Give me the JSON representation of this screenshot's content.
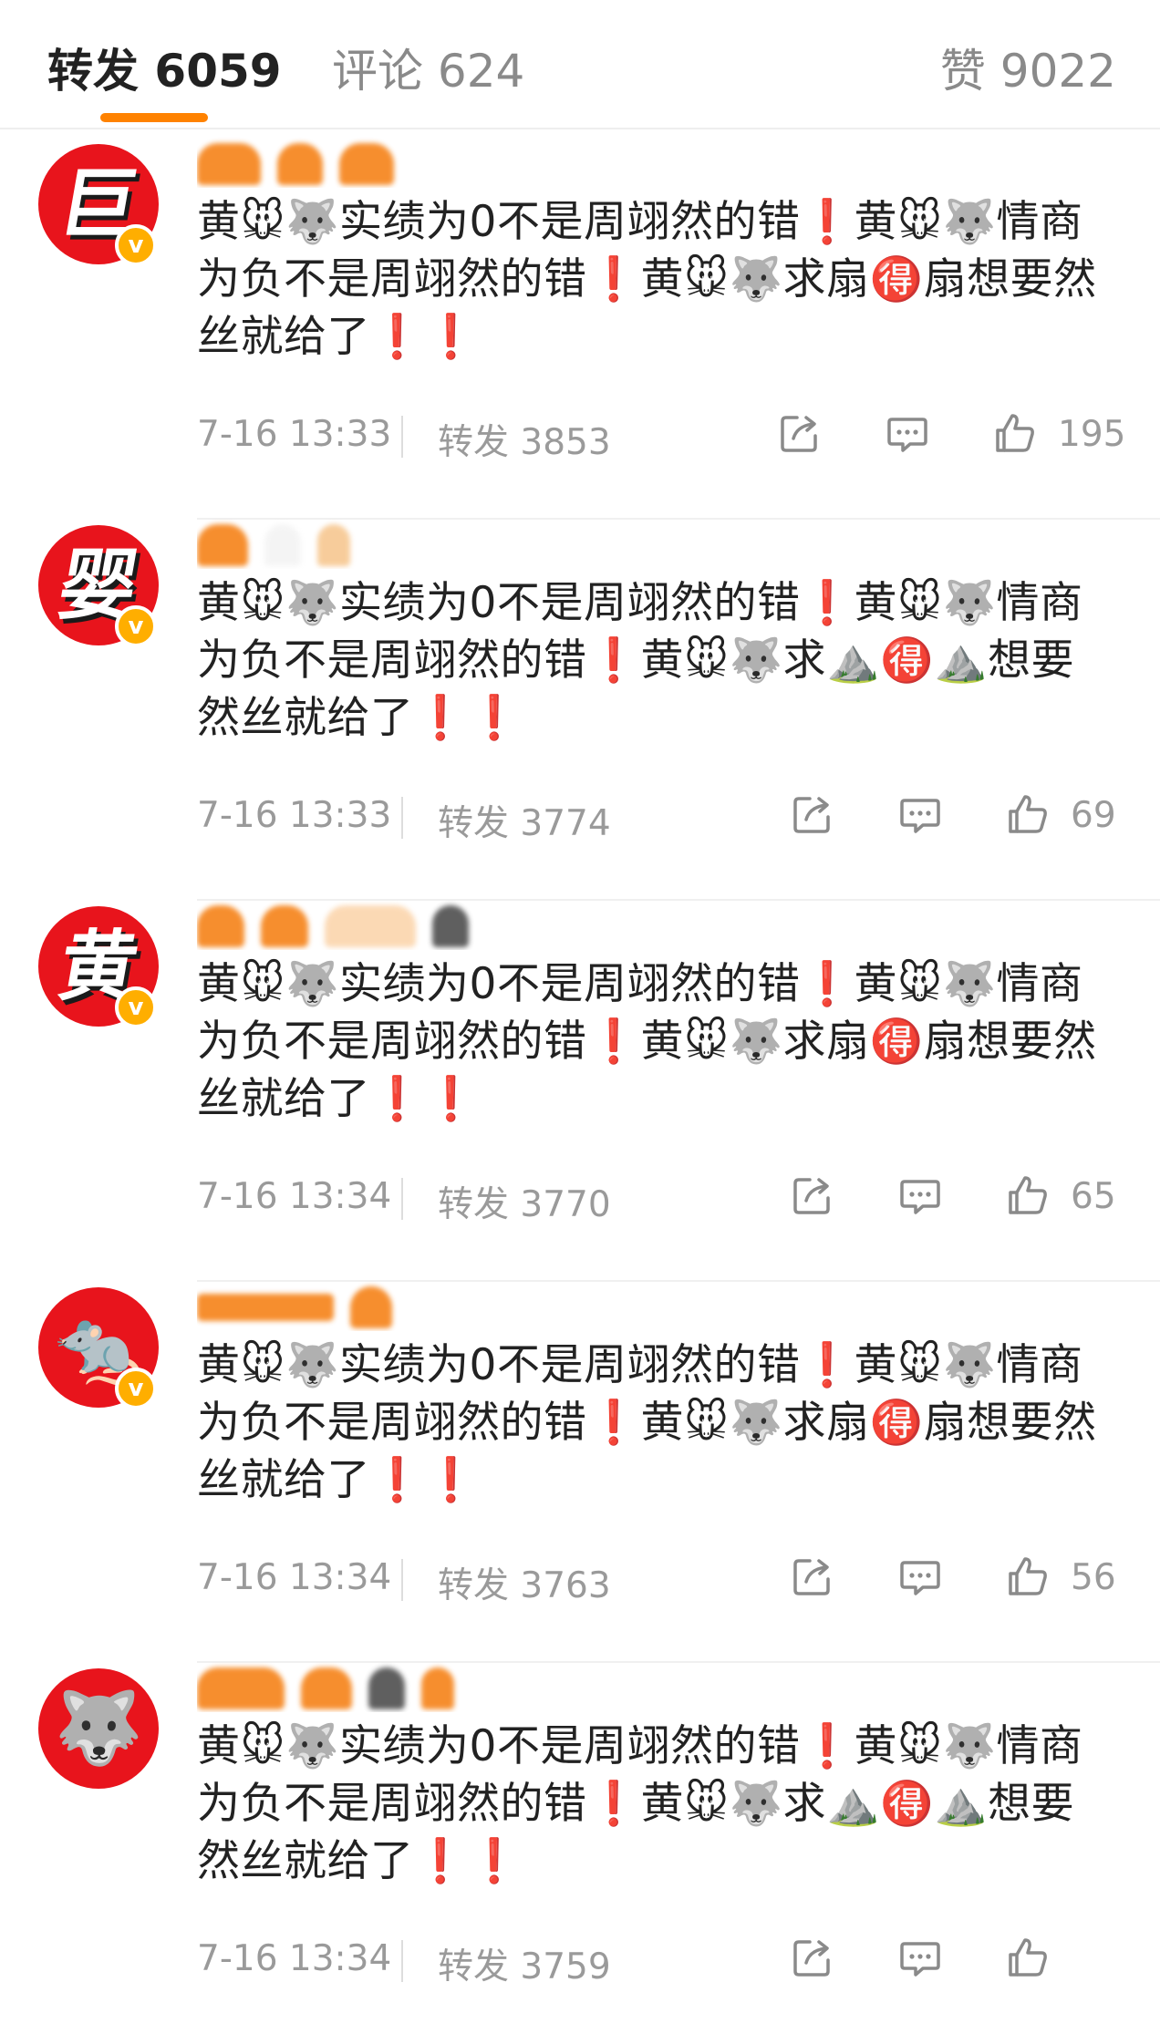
{
  "tabs": {
    "repost_label": "转发 6059",
    "comment_label": "评论 624",
    "like_label": "赞 9022",
    "accent_color": "#ff8200"
  },
  "icons": {
    "share": "share-icon",
    "comment": "comment-icon",
    "like": "thumbs-up-icon",
    "verified": "verified-badge-icon"
  },
  "verified_badge": "v",
  "posts": [
    {
      "avatar": "巨",
      "text": "黄🐭🐺实绩为0不是周翊然的错❗黄🐭🐺情商为负不是周翊然的错❗黄🐭🐺求扇🉐扇想要然丝就给了❗❗",
      "time": "7-16 13:33",
      "repost": "转发 3853",
      "likes": "195"
    },
    {
      "avatar": "婴",
      "text": "黄🐭🐺实绩为0不是周翊然的错❗黄🐭🐺情商为负不是周翊然的错❗黄🐭🐺求⛰️🉐⛰️想要然丝就给了❗❗",
      "time": "7-16 13:33",
      "repost": "转发 3774",
      "likes": "69"
    },
    {
      "avatar": "黄",
      "text": "黄🐭🐺实绩为0不是周翊然的错❗黄🐭🐺情商为负不是周翊然的错❗黄🐭🐺求扇🉐扇想要然丝就给了❗❗",
      "time": "7-16 13:34",
      "repost": "转发 3770",
      "likes": "65"
    },
    {
      "avatar": "🐀",
      "text": "黄🐭🐺实绩为0不是周翊然的错❗黄🐭🐺情商为负不是周翊然的错❗黄🐭🐺求扇🉐扇想要然丝就给了❗❗",
      "time": "7-16 13:34",
      "repost": "转发 3763",
      "likes": "56"
    },
    {
      "avatar": "🐺",
      "text": "黄🐭🐺实绩为0不是周翊然的错❗黄🐭🐺情商为负不是周翊然的错❗黄🐭🐺求⛰️🉐⛰️想要然丝就给了❗❗",
      "time": "7-16 13:34",
      "repost": "转发 3759",
      "likes": ""
    }
  ]
}
